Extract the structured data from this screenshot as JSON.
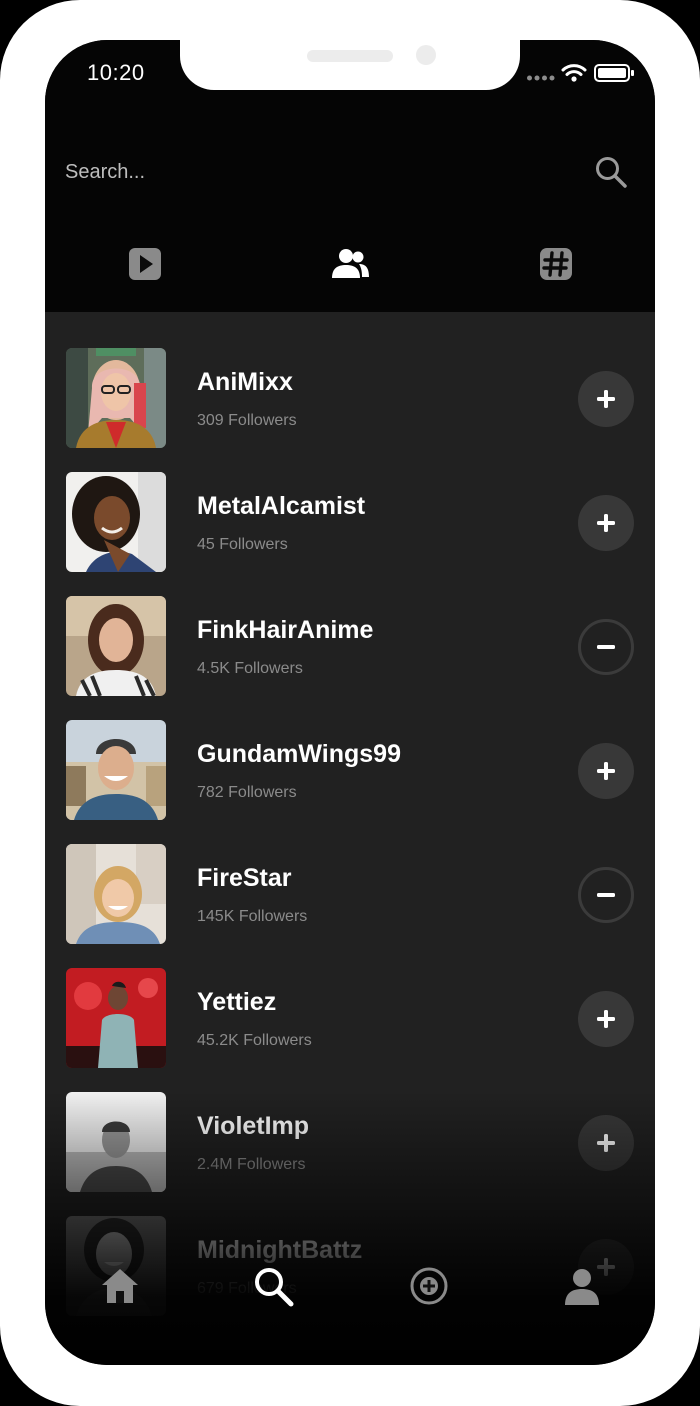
{
  "status_bar": {
    "time": "10:20"
  },
  "search": {
    "placeholder": "Search..."
  },
  "tabs": [
    {
      "id": "videos",
      "icon": "play-square-icon",
      "active": false
    },
    {
      "id": "users",
      "icon": "users-icon",
      "active": true
    },
    {
      "id": "hashtags",
      "icon": "hashtag-icon",
      "active": false
    }
  ],
  "users": [
    {
      "name": "AniMixx",
      "followers": "309 Followers",
      "state": "follow"
    },
    {
      "name": "MetalAlcamist",
      "followers": "45 Followers",
      "state": "follow"
    },
    {
      "name": "FinkHairAnime",
      "followers": "4.5K Followers",
      "state": "following"
    },
    {
      "name": "GundamWings99",
      "followers": "782 Followers",
      "state": "follow"
    },
    {
      "name": "FireStar",
      "followers": "145K Followers",
      "state": "following"
    },
    {
      "name": "Yettiez",
      "followers": "45.2K Followers",
      "state": "follow"
    },
    {
      "name": "VioletImp",
      "followers": "2.4M Followers",
      "state": "follow"
    },
    {
      "name": "MidnightBattz",
      "followers": "679 Followers",
      "state": "follow"
    }
  ],
  "bottom_nav": [
    {
      "id": "home",
      "icon": "home-icon",
      "active": false
    },
    {
      "id": "search",
      "icon": "search-icon",
      "active": true
    },
    {
      "id": "add",
      "icon": "add-circle-icon",
      "active": false
    },
    {
      "id": "profile",
      "icon": "profile-icon",
      "active": false
    }
  ],
  "colors": {
    "background": "#212121",
    "header": "#050505",
    "text_primary": "#ffffff",
    "text_secondary": "#8b8b8b",
    "button_fill": "#383838",
    "inactive_icon": "#8a8a8a"
  }
}
